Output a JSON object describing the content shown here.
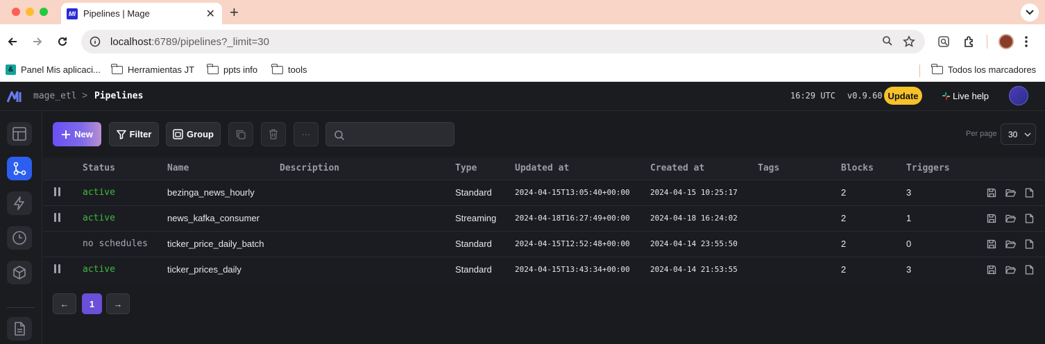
{
  "browser": {
    "tab_title": "Pipelines | Mage",
    "tab_favicon": "MI",
    "url_host": "localhost",
    "url_path": ":6789/pipelines?_limit=30",
    "bookmarks": [
      {
        "label": "Panel Mis aplicaci...",
        "icon": "app-icon"
      },
      {
        "label": "Herramientas JT",
        "icon": "folder-icon"
      },
      {
        "label": "ppts info",
        "icon": "folder-icon"
      },
      {
        "label": "tools",
        "icon": "folder-icon"
      }
    ],
    "all_bookmarks": "Todos los marcadores"
  },
  "header": {
    "project": "mage_etl",
    "separator": ">",
    "page": "Pipelines",
    "time": "16:29 UTC",
    "version": "v0.9.60",
    "update_label": "Update",
    "live_help_label": "Live help"
  },
  "sidebar": {
    "items": [
      {
        "name": "overview-icon",
        "active": false
      },
      {
        "name": "pipelines-icon",
        "active": true
      },
      {
        "name": "triggers-icon",
        "active": false
      },
      {
        "name": "history-icon",
        "active": false
      },
      {
        "name": "blocks-icon",
        "active": false
      },
      {
        "name": "files-icon",
        "active": false
      }
    ]
  },
  "toolbar": {
    "new_label": "New",
    "filter_label": "Filter",
    "group_label": "Group",
    "more_label": "···",
    "search_placeholder": "",
    "per_page_label": "Per page",
    "per_page_value": "30"
  },
  "table": {
    "columns": [
      "Status",
      "Name",
      "Description",
      "Type",
      "Updated at",
      "Created at",
      "Tags",
      "Blocks",
      "Triggers"
    ],
    "rows": [
      {
        "paused_toggle": true,
        "status": "active",
        "name": "bezinga_news_hourly",
        "description": "",
        "type": "Standard",
        "updated_at": "2024-04-15T13:05:40+00:00",
        "created_at": "2024-04-15 10:25:17",
        "tags": "",
        "blocks": "2",
        "triggers": "3"
      },
      {
        "paused_toggle": true,
        "status": "active",
        "name": "news_kafka_consumer",
        "description": "",
        "type": "Streaming",
        "updated_at": "2024-04-18T16:27:49+00:00",
        "created_at": "2024-04-18 16:24:02",
        "tags": "",
        "blocks": "2",
        "triggers": "1"
      },
      {
        "paused_toggle": false,
        "status": "no schedules",
        "name": "ticker_price_daily_batch",
        "description": "",
        "type": "Standard",
        "updated_at": "2024-04-15T12:52:48+00:00",
        "created_at": "2024-04-14 23:55:50",
        "tags": "",
        "blocks": "2",
        "triggers": "0"
      },
      {
        "paused_toggle": true,
        "status": "active",
        "name": "ticker_prices_daily",
        "description": "",
        "type": "Standard",
        "updated_at": "2024-04-15T13:43:34+00:00",
        "created_at": "2024-04-14 21:53:55",
        "tags": "",
        "blocks": "2",
        "triggers": "3"
      }
    ]
  },
  "pagination": {
    "prev": "←",
    "current": "1",
    "next": "→"
  },
  "colors": {
    "accent": "#6b4fd8",
    "active_status": "#3fba3f",
    "update_button": "#f6c12a",
    "sidebar_active": "#2c5ef0"
  }
}
